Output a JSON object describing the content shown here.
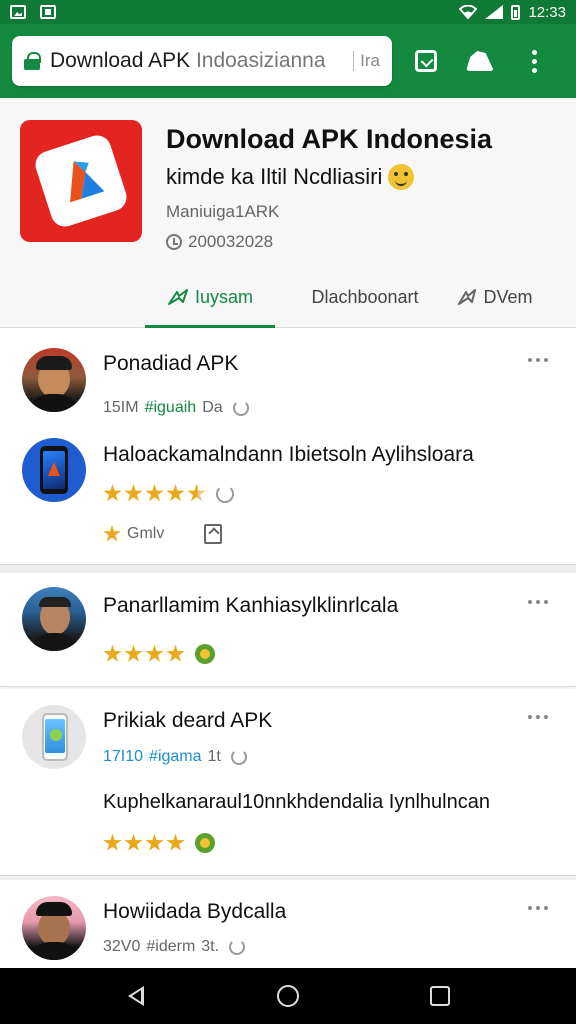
{
  "status_bar": {
    "time": "12:33"
  },
  "browser": {
    "url_main": "Download APK ",
    "url_dim": "Indoasizianna",
    "url_tail": "Ira"
  },
  "app": {
    "title": "Download APK Indonesia",
    "subtitle": "kimde ka Iltil Ncdliasiri",
    "developer": "Maniuiga1ARK",
    "date": "200032028",
    "accent_color": "#138a3f",
    "icon_color": "#e32420"
  },
  "tabs": [
    {
      "label": "Iuysam"
    },
    {
      "label": "Dlachboonart"
    },
    {
      "label": "DVem"
    }
  ],
  "items": [
    {
      "title": "Ponadiad APK",
      "meta_size": "15IM",
      "meta_tag": "#iguaih",
      "meta_extra": "Da"
    },
    {
      "title": "Haloackamalndann Ibietsoln Aylihsloara",
      "rating": 4.5,
      "foot_label": "Gmlv"
    },
    {
      "title": "Panarllamim Kanhiasylklinrlcala",
      "rating": 4
    },
    {
      "title": "Prikiak deard APK",
      "meta_size": "17I10",
      "meta_tag": "#igama",
      "meta_extra": "1t",
      "desc": "Kuphelkanaraul10nnkhdendalia Iynlhulncan",
      "rating": 4
    },
    {
      "title": "Howiidada Bydcalla",
      "meta_size": "32V0",
      "meta_tag": "#iderm",
      "meta_extra": "3t."
    }
  ]
}
